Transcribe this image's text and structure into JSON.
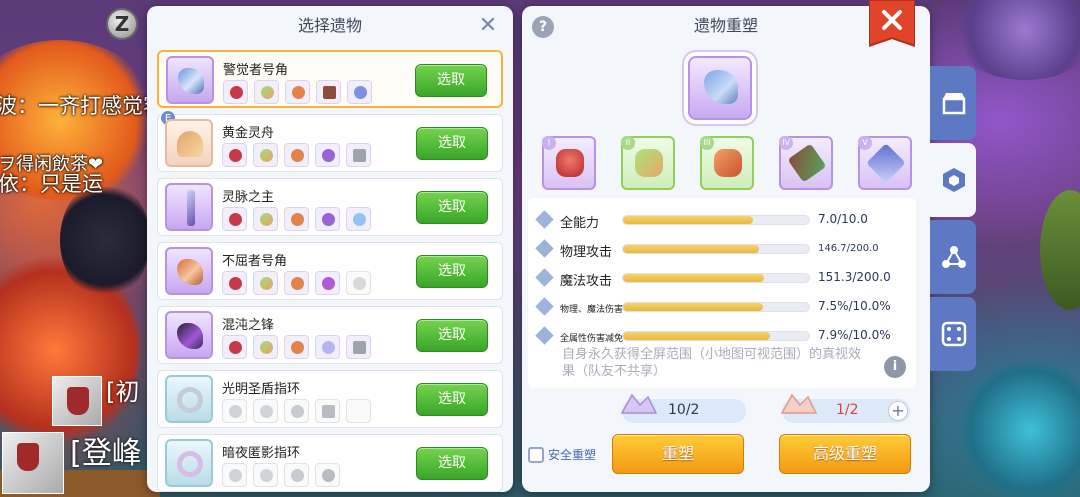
{
  "background": {
    "chat_lines": [
      "波：一齐打感觉容易掉线",
      "ヲ得闲飲茶❤",
      "依：只是运",
      "[初",
      "[登峰"
    ]
  },
  "select_panel": {
    "title": "选择遗物",
    "items": [
      {
        "name": "警觉者号角",
        "button": "选取",
        "selected": true,
        "tag": ""
      },
      {
        "name": "黄金灵舟",
        "button": "选取",
        "selected": false,
        "tag": "E"
      },
      {
        "name": "灵脉之主",
        "button": "选取",
        "selected": false,
        "tag": ""
      },
      {
        "name": "不屈者号角",
        "button": "选取",
        "selected": false,
        "tag": ""
      },
      {
        "name": "混沌之锋",
        "button": "选取",
        "selected": false,
        "tag": ""
      },
      {
        "name": "光明圣盾指环",
        "button": "选取",
        "selected": false,
        "tag": ""
      },
      {
        "name": "暗夜匿影指环",
        "button": "选取",
        "selected": false,
        "tag": ""
      }
    ]
  },
  "reshape_panel": {
    "title": "遗物重塑",
    "help": "?",
    "slots": [
      "I",
      "II",
      "III",
      "IV",
      "V"
    ],
    "stats": [
      {
        "label": "全能力",
        "value": "7.0/10.0",
        "fill": 0.7
      },
      {
        "label": "物理攻击",
        "value": "146.7/200.0",
        "fill": 0.733
      },
      {
        "label": "魔法攻击",
        "value": "151.3/200.0",
        "fill": 0.757
      },
      {
        "label": "物理、魔法伤害",
        "value": "7.5%/10.0%",
        "fill": 0.75
      },
      {
        "label": "全属性伤害减免",
        "value": "7.9%/10.0%",
        "fill": 0.79
      }
    ],
    "effect": "自身永久获得全屏范围（小地图可视范围）的真视效果（队友不共享）",
    "info": "i",
    "cost_1": "10/2",
    "cost_2": "1/2",
    "plus": "+",
    "safe_label": "安全重塑",
    "btn_reshape": "重塑",
    "btn_advanced": "高级重塑"
  },
  "colors": {
    "accent_green": "#3aa62a",
    "accent_orange": "#f39a12",
    "close_red": "#e0452a",
    "tab_blue": "#5d79c4",
    "cost_red": "#d9432f"
  },
  "icons": {
    "close": "close-icon",
    "help": "help-icon",
    "info": "info-icon",
    "shop": "shop-icon",
    "relic": "relic-icon",
    "share": "share-icon",
    "dice": "dice-icon"
  }
}
